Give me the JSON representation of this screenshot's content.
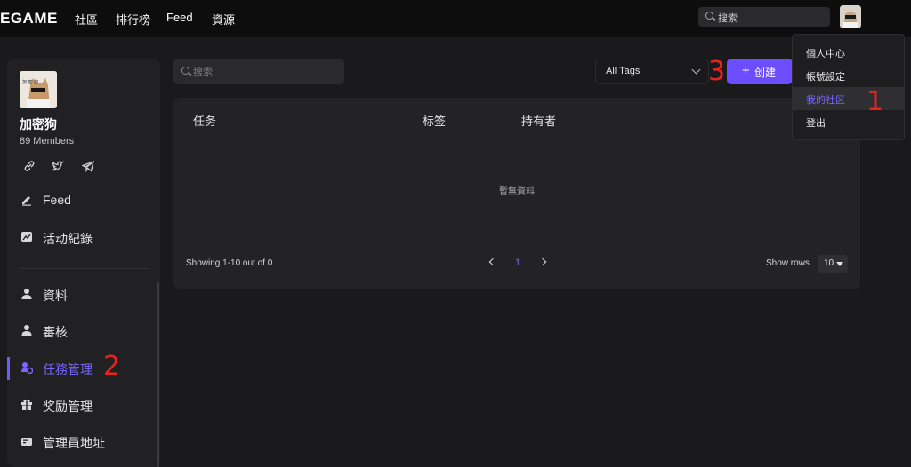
{
  "topbar": {
    "logo": "EGAME",
    "nav": [
      "社區",
      "排行榜",
      "Feed",
      "資源"
    ],
    "search_label": "搜索"
  },
  "sidebar": {
    "community_name": "加密狗",
    "members": "89 Members",
    "social_icons": [
      "link-icon",
      "twitter-icon",
      "telegram-icon"
    ],
    "items": [
      {
        "label": "Feed",
        "icon": "pencil-icon"
      },
      {
        "label": "活动紀錄",
        "icon": "chart-icon"
      },
      {
        "label": "資料",
        "icon": "user-icon"
      },
      {
        "label": "審核",
        "icon": "user-check-icon"
      },
      {
        "label": "任務管理",
        "icon": "task-icon"
      },
      {
        "label": "奖励管理",
        "icon": "gift-icon"
      },
      {
        "label": "管理員地址",
        "icon": "wallet-icon"
      }
    ]
  },
  "main": {
    "search_placeholder": "搜索",
    "tags_select": "All Tags",
    "create_button": "创建",
    "table": {
      "columns": [
        "任务",
        "标签",
        "持有者"
      ],
      "empty": "暫無資料",
      "showing": "Showing 1-10 out of 0",
      "page": "1",
      "rows_label": "Show rows",
      "rows_value": "10"
    }
  },
  "dropdown": {
    "items": [
      "個人中心",
      "帳號設定",
      "我的社区",
      "登出"
    ],
    "highlighted": "我的社区"
  },
  "annotations": [
    "1",
    "2",
    "3"
  ],
  "colors": {
    "accent": "#6c4dff",
    "active_text": "#7a66ff",
    "annotation": "#e8221c",
    "background": "#1a1a1c"
  }
}
